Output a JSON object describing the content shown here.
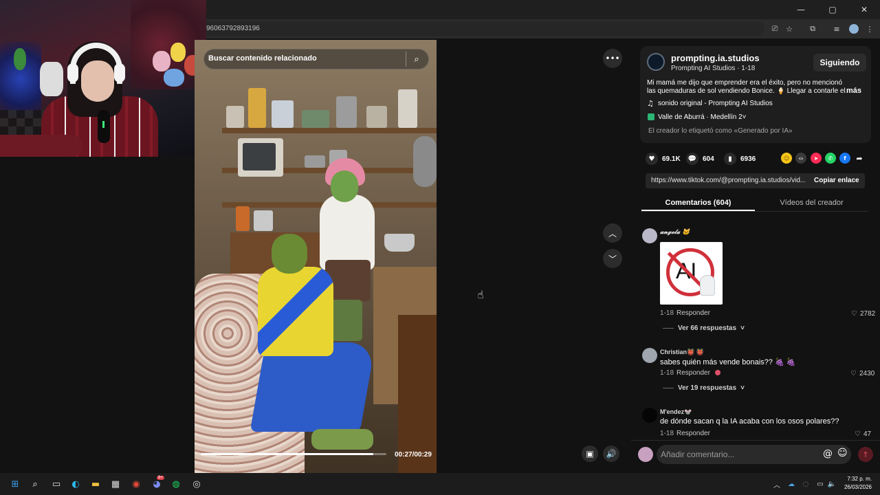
{
  "browser": {
    "url": "96063792893196",
    "window_controls": [
      "—",
      "▢",
      "✕"
    ]
  },
  "video": {
    "search_label": "Buscar contenido relacionado",
    "time": "00:27/00:29",
    "progress": 0.93
  },
  "creator": {
    "handle": "prompting.ia.studios",
    "subtitle": "Prompting AI Studios · 1-18",
    "follow_label": "Siguiendo",
    "description_line1": "Mi mamá me dijo que emprender era el éxito, pero no mencionó",
    "description_line2": "las quemaduras de sol vendiendo Bonice. 🍦 Llegar a contarle el...",
    "more_label": "más",
    "music": "sonido original - Prompting AI Studios",
    "location": "Valle de Aburrá · Medellín",
    "location_count": "2",
    "ai_label": "El creador lo etiquetó como «Generado por IA»"
  },
  "stats": {
    "likes": "69.1K",
    "comments": "604",
    "saves": "6936"
  },
  "share": {
    "link": "https://www.tiktok.com/@prompting.ia.studios/vid...",
    "copy_label": "Copiar enlace",
    "colors": {
      "coin": "#f5c518",
      "embed": "#3a3a3a",
      "send": "#fe2c55",
      "whatsapp": "#25d366",
      "facebook": "#1877f2"
    }
  },
  "tabs": {
    "comments": "Comentarios (604)",
    "videos": "Vídeos del creador"
  },
  "comments": [
    {
      "name": "𝓪𝓷𝓰𝓮𝓵𝓪 🐱",
      "text": "",
      "image_text": "AI",
      "date": "1-18",
      "reply": "Responder",
      "likes": "2782",
      "more": "Ver 66 respuestas"
    },
    {
      "name": "Christian👹 👹",
      "text": "sabes quién más vende bonais?? 🍇 🍇",
      "date": "1-18",
      "reply": "Responder",
      "likes": "2430",
      "more": "Ver 19 respuestas"
    },
    {
      "name": "M'endez🐭",
      "text": "de dónde sacan q la IA acaba con los osos polares??",
      "date": "1-18",
      "reply": "Responder",
      "likes": "47"
    }
  ],
  "comment_box": {
    "placeholder": "Añadir comentario..."
  },
  "taskbar": {
    "time": "7:32 p. m.",
    "date": "26/03/2026",
    "chat_badge": "9+"
  }
}
